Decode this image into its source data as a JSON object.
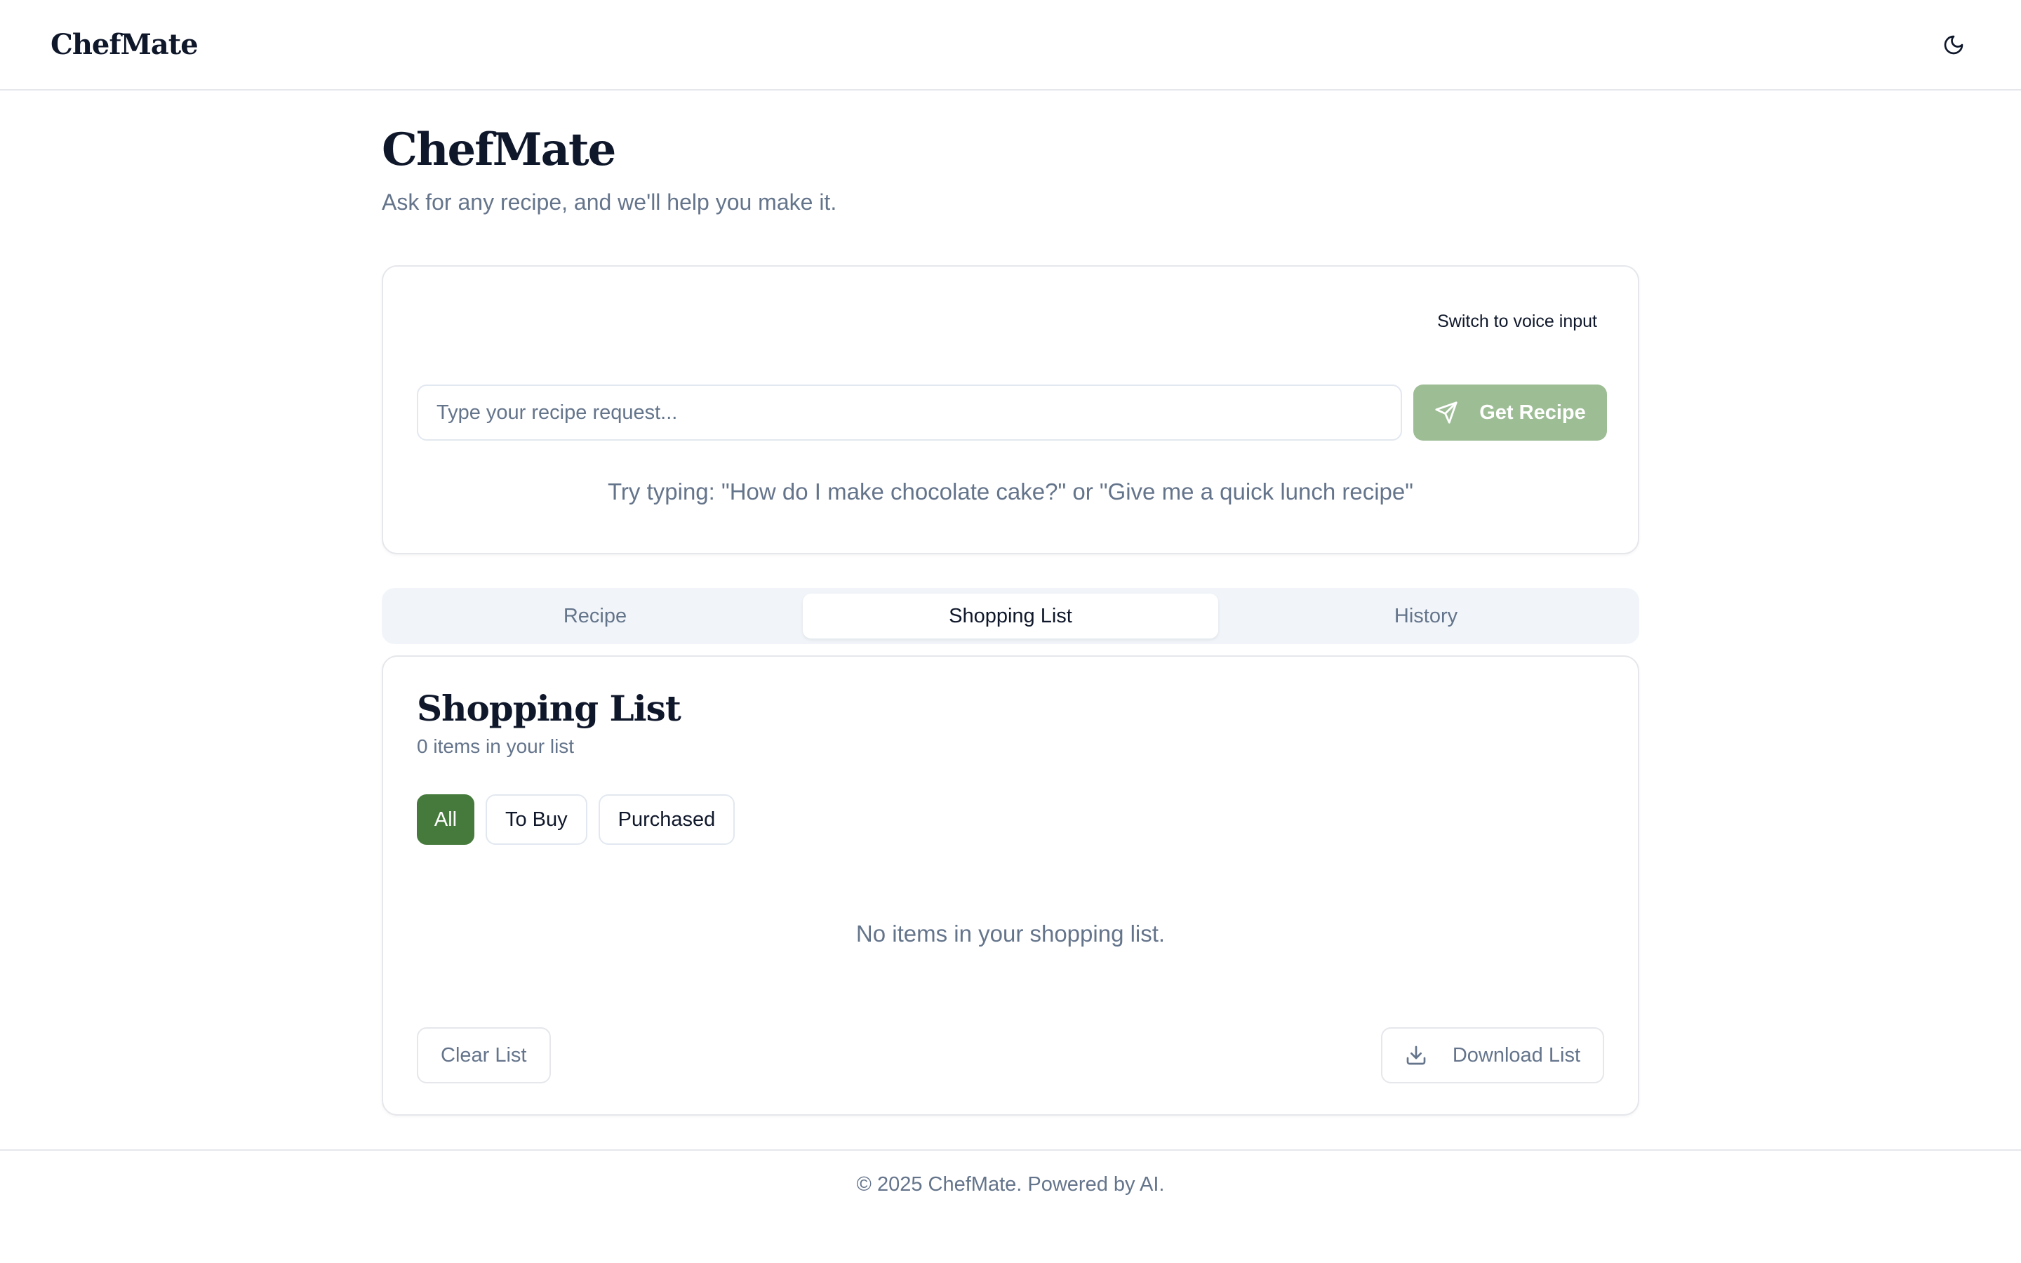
{
  "header": {
    "brand": "ChefMate",
    "theme_icon": "moon-icon"
  },
  "hero": {
    "title": "ChefMate",
    "subtitle": "Ask for any recipe, and we'll help you make it."
  },
  "input_card": {
    "voice_toggle_label": "Switch to voice input",
    "input_value": "",
    "input_placeholder": "Type your recipe request...",
    "submit_label": "Get Recipe",
    "submit_icon": "send-icon",
    "hint": "Try typing: \"How do I make chocolate cake?\" or \"Give me a quick lunch recipe\""
  },
  "tabs": [
    {
      "label": "Recipe",
      "active": false
    },
    {
      "label": "Shopping List",
      "active": true
    },
    {
      "label": "History",
      "active": false
    }
  ],
  "shopping_list": {
    "title": "Shopping List",
    "count_text": "0 items in your list",
    "filters": [
      {
        "label": "All",
        "active": true
      },
      {
        "label": "To Buy",
        "active": false
      },
      {
        "label": "Purchased",
        "active": false
      }
    ],
    "empty_message": "No items in your shopping list.",
    "clear_label": "Clear List",
    "download_label": "Download List",
    "download_icon": "download-icon"
  },
  "footer": {
    "text": "© 2025 ChefMate. Powered by AI."
  },
  "colors": {
    "primary": "#467a3c",
    "primary_disabled": "#9dbd95",
    "muted_text": "#64748b",
    "border": "#e5e7eb",
    "tabs_bg": "#f1f5f9"
  }
}
